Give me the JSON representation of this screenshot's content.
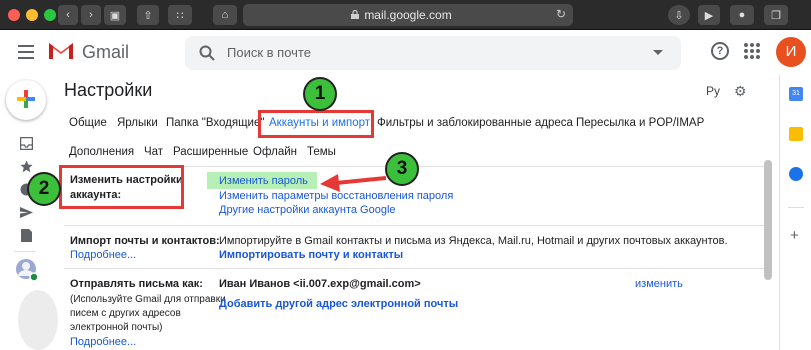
{
  "browser": {
    "url": "mail.google.com"
  },
  "header": {
    "app_name": "Gmail",
    "search_placeholder": "Поиск в почте",
    "help_label": "?",
    "avatar_letter": "И",
    "avatar_color": "#e8511f"
  },
  "settings": {
    "title": "Настройки",
    "language_label": "Ру",
    "tabs_row1": [
      "Общие",
      "Ярлыки",
      "Папка \"Входящие\"",
      "Аккаунты и импорт",
      "Фильтры и заблокированные адреса",
      "Пересылка и POP/IMAP"
    ],
    "tabs_row2": [
      "Дополнения",
      "Чат",
      "Расширенные",
      "Офлайн",
      "Темы"
    ],
    "active_tab": "Аккаунты и импорт",
    "sections": {
      "account": {
        "label_line1": "Изменить настройки",
        "label_line2": "аккаунта:",
        "links": [
          "Изменить пароль",
          "Изменить параметры восстановления пароля",
          "Другие настройки аккаунта Google"
        ]
      },
      "import": {
        "label": "Импорт почты и контактов:",
        "more": "Подробнее...",
        "description": "Импортируйте в Gmail контакты и письма из Яндекса, Mail.ru, Hotmail и других почтовых аккаунтов.",
        "action": "Импортировать почту и контакты"
      },
      "send_as": {
        "label": "Отправлять письма как:",
        "note_line1": "(Используйте Gmail для отправки",
        "note_line2": "писем с других адресов",
        "note_line3": "электронной почты)",
        "more": "Подробнее...",
        "identity": "Иван Иванов <ii.007.exp@gmail.com>",
        "edit": "изменить",
        "add": "Добавить другой адрес электронной почты"
      }
    }
  },
  "annotations": {
    "badge1": "1",
    "badge2": "2",
    "badge3": "3",
    "badge_color": "#3cc03c",
    "box_color": "#e53935"
  }
}
